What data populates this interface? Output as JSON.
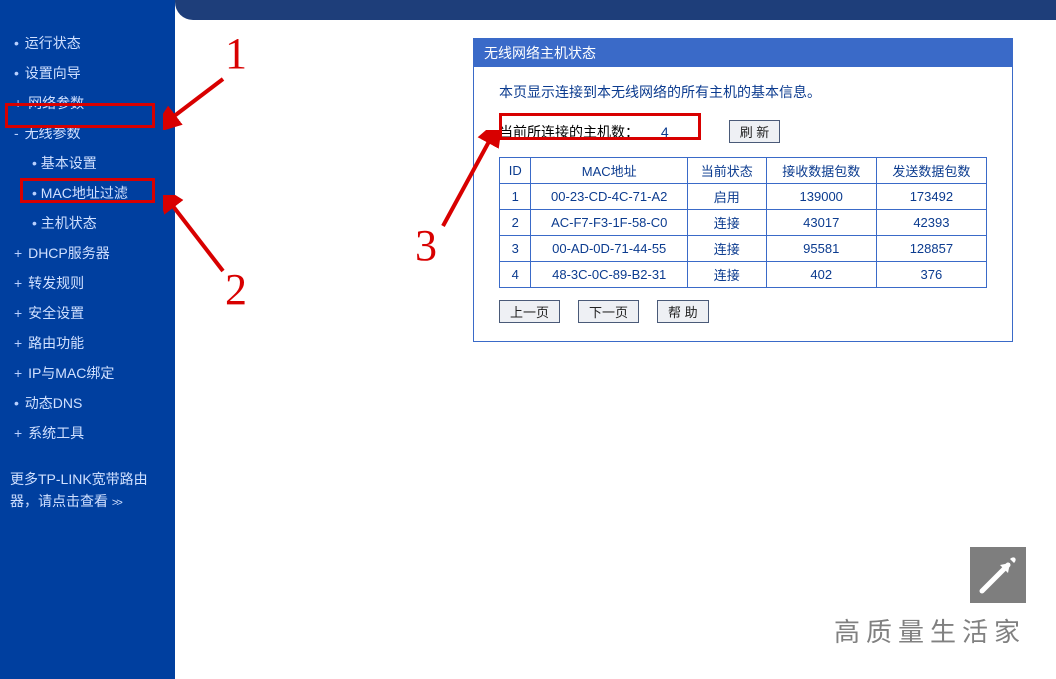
{
  "sidebar": {
    "items": [
      {
        "label": "运行状态",
        "cls": "lvl1"
      },
      {
        "label": "设置向导",
        "cls": "lvl1"
      },
      {
        "label": "网络参数",
        "cls": "lvl1 expand"
      },
      {
        "label": "无线参数",
        "cls": "lvl1 collapse"
      },
      {
        "label": "基本设置",
        "cls": "sub"
      },
      {
        "label": "MAC地址过滤",
        "cls": "sub"
      },
      {
        "label": "主机状态",
        "cls": "sub"
      },
      {
        "label": "DHCP服务器",
        "cls": "lvl1 expand"
      },
      {
        "label": "转发规则",
        "cls": "lvl1 expand"
      },
      {
        "label": "安全设置",
        "cls": "lvl1 expand"
      },
      {
        "label": "路由功能",
        "cls": "lvl1 expand"
      },
      {
        "label": "IP与MAC绑定",
        "cls": "lvl1 expand"
      },
      {
        "label": "动态DNS",
        "cls": "lvl1"
      },
      {
        "label": "系统工具",
        "cls": "lvl1 expand"
      }
    ],
    "more_line1": "更多TP-LINK宽带路由",
    "more_line2": "器，请点击查看 ",
    "more_arrow": ">>"
  },
  "panel": {
    "title": "无线网络主机状态",
    "desc": "本页显示连接到本无线网络的所有主机的基本信息。",
    "count_label": "当前所连接的主机数：",
    "count_value": "4",
    "refresh": "刷 新",
    "headers": {
      "id": "ID",
      "mac": "MAC地址",
      "status": "当前状态",
      "rx": "接收数据包数",
      "tx": "发送数据包数"
    },
    "rows": [
      {
        "id": "1",
        "mac": "00-23-CD-4C-71-A2",
        "status": "启用",
        "rx": "139000",
        "tx": "173492"
      },
      {
        "id": "2",
        "mac": "AC-F7-F3-1F-58-C0",
        "status": "连接",
        "rx": "43017",
        "tx": "42393"
      },
      {
        "id": "3",
        "mac": "00-AD-0D-71-44-55",
        "status": "连接",
        "rx": "95581",
        "tx": "128857"
      },
      {
        "id": "4",
        "mac": "48-3C-0C-89-B2-31",
        "status": "连接",
        "rx": "402",
        "tx": "376"
      }
    ],
    "prev": "上一页",
    "next": "下一页",
    "help": "帮 助"
  },
  "annotations": {
    "n1": "1",
    "n2": "2",
    "n3": "3"
  },
  "watermark": {
    "text": "高质量生活家"
  }
}
